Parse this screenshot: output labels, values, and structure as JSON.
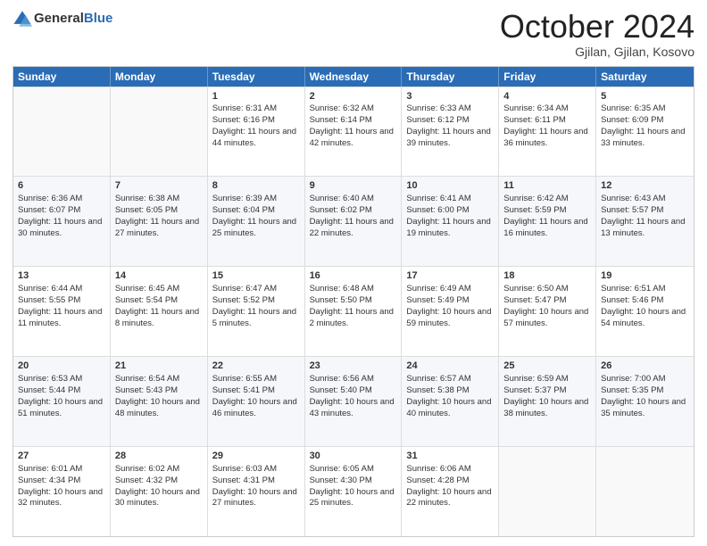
{
  "header": {
    "logo_general": "General",
    "logo_blue": "Blue",
    "month_title": "October 2024",
    "location": "Gjilan, Gjilan, Kosovo"
  },
  "days_of_week": [
    "Sunday",
    "Monday",
    "Tuesday",
    "Wednesday",
    "Thursday",
    "Friday",
    "Saturday"
  ],
  "weeks": [
    [
      {
        "day": "",
        "sunrise": "",
        "sunset": "",
        "daylight": ""
      },
      {
        "day": "",
        "sunrise": "",
        "sunset": "",
        "daylight": ""
      },
      {
        "day": "1",
        "sunrise": "Sunrise: 6:31 AM",
        "sunset": "Sunset: 6:16 PM",
        "daylight": "Daylight: 11 hours and 44 minutes."
      },
      {
        "day": "2",
        "sunrise": "Sunrise: 6:32 AM",
        "sunset": "Sunset: 6:14 PM",
        "daylight": "Daylight: 11 hours and 42 minutes."
      },
      {
        "day": "3",
        "sunrise": "Sunrise: 6:33 AM",
        "sunset": "Sunset: 6:12 PM",
        "daylight": "Daylight: 11 hours and 39 minutes."
      },
      {
        "day": "4",
        "sunrise": "Sunrise: 6:34 AM",
        "sunset": "Sunset: 6:11 PM",
        "daylight": "Daylight: 11 hours and 36 minutes."
      },
      {
        "day": "5",
        "sunrise": "Sunrise: 6:35 AM",
        "sunset": "Sunset: 6:09 PM",
        "daylight": "Daylight: 11 hours and 33 minutes."
      }
    ],
    [
      {
        "day": "6",
        "sunrise": "Sunrise: 6:36 AM",
        "sunset": "Sunset: 6:07 PM",
        "daylight": "Daylight: 11 hours and 30 minutes."
      },
      {
        "day": "7",
        "sunrise": "Sunrise: 6:38 AM",
        "sunset": "Sunset: 6:05 PM",
        "daylight": "Daylight: 11 hours and 27 minutes."
      },
      {
        "day": "8",
        "sunrise": "Sunrise: 6:39 AM",
        "sunset": "Sunset: 6:04 PM",
        "daylight": "Daylight: 11 hours and 25 minutes."
      },
      {
        "day": "9",
        "sunrise": "Sunrise: 6:40 AM",
        "sunset": "Sunset: 6:02 PM",
        "daylight": "Daylight: 11 hours and 22 minutes."
      },
      {
        "day": "10",
        "sunrise": "Sunrise: 6:41 AM",
        "sunset": "Sunset: 6:00 PM",
        "daylight": "Daylight: 11 hours and 19 minutes."
      },
      {
        "day": "11",
        "sunrise": "Sunrise: 6:42 AM",
        "sunset": "Sunset: 5:59 PM",
        "daylight": "Daylight: 11 hours and 16 minutes."
      },
      {
        "day": "12",
        "sunrise": "Sunrise: 6:43 AM",
        "sunset": "Sunset: 5:57 PM",
        "daylight": "Daylight: 11 hours and 13 minutes."
      }
    ],
    [
      {
        "day": "13",
        "sunrise": "Sunrise: 6:44 AM",
        "sunset": "Sunset: 5:55 PM",
        "daylight": "Daylight: 11 hours and 11 minutes."
      },
      {
        "day": "14",
        "sunrise": "Sunrise: 6:45 AM",
        "sunset": "Sunset: 5:54 PM",
        "daylight": "Daylight: 11 hours and 8 minutes."
      },
      {
        "day": "15",
        "sunrise": "Sunrise: 6:47 AM",
        "sunset": "Sunset: 5:52 PM",
        "daylight": "Daylight: 11 hours and 5 minutes."
      },
      {
        "day": "16",
        "sunrise": "Sunrise: 6:48 AM",
        "sunset": "Sunset: 5:50 PM",
        "daylight": "Daylight: 11 hours and 2 minutes."
      },
      {
        "day": "17",
        "sunrise": "Sunrise: 6:49 AM",
        "sunset": "Sunset: 5:49 PM",
        "daylight": "Daylight: 10 hours and 59 minutes."
      },
      {
        "day": "18",
        "sunrise": "Sunrise: 6:50 AM",
        "sunset": "Sunset: 5:47 PM",
        "daylight": "Daylight: 10 hours and 57 minutes."
      },
      {
        "day": "19",
        "sunrise": "Sunrise: 6:51 AM",
        "sunset": "Sunset: 5:46 PM",
        "daylight": "Daylight: 10 hours and 54 minutes."
      }
    ],
    [
      {
        "day": "20",
        "sunrise": "Sunrise: 6:53 AM",
        "sunset": "Sunset: 5:44 PM",
        "daylight": "Daylight: 10 hours and 51 minutes."
      },
      {
        "day": "21",
        "sunrise": "Sunrise: 6:54 AM",
        "sunset": "Sunset: 5:43 PM",
        "daylight": "Daylight: 10 hours and 48 minutes."
      },
      {
        "day": "22",
        "sunrise": "Sunrise: 6:55 AM",
        "sunset": "Sunset: 5:41 PM",
        "daylight": "Daylight: 10 hours and 46 minutes."
      },
      {
        "day": "23",
        "sunrise": "Sunrise: 6:56 AM",
        "sunset": "Sunset: 5:40 PM",
        "daylight": "Daylight: 10 hours and 43 minutes."
      },
      {
        "day": "24",
        "sunrise": "Sunrise: 6:57 AM",
        "sunset": "Sunset: 5:38 PM",
        "daylight": "Daylight: 10 hours and 40 minutes."
      },
      {
        "day": "25",
        "sunrise": "Sunrise: 6:59 AM",
        "sunset": "Sunset: 5:37 PM",
        "daylight": "Daylight: 10 hours and 38 minutes."
      },
      {
        "day": "26",
        "sunrise": "Sunrise: 7:00 AM",
        "sunset": "Sunset: 5:35 PM",
        "daylight": "Daylight: 10 hours and 35 minutes."
      }
    ],
    [
      {
        "day": "27",
        "sunrise": "Sunrise: 6:01 AM",
        "sunset": "Sunset: 4:34 PM",
        "daylight": "Daylight: 10 hours and 32 minutes."
      },
      {
        "day": "28",
        "sunrise": "Sunrise: 6:02 AM",
        "sunset": "Sunset: 4:32 PM",
        "daylight": "Daylight: 10 hours and 30 minutes."
      },
      {
        "day": "29",
        "sunrise": "Sunrise: 6:03 AM",
        "sunset": "Sunset: 4:31 PM",
        "daylight": "Daylight: 10 hours and 27 minutes."
      },
      {
        "day": "30",
        "sunrise": "Sunrise: 6:05 AM",
        "sunset": "Sunset: 4:30 PM",
        "daylight": "Daylight: 10 hours and 25 minutes."
      },
      {
        "day": "31",
        "sunrise": "Sunrise: 6:06 AM",
        "sunset": "Sunset: 4:28 PM",
        "daylight": "Daylight: 10 hours and 22 minutes."
      },
      {
        "day": "",
        "sunrise": "",
        "sunset": "",
        "daylight": ""
      },
      {
        "day": "",
        "sunrise": "",
        "sunset": "",
        "daylight": ""
      }
    ]
  ]
}
